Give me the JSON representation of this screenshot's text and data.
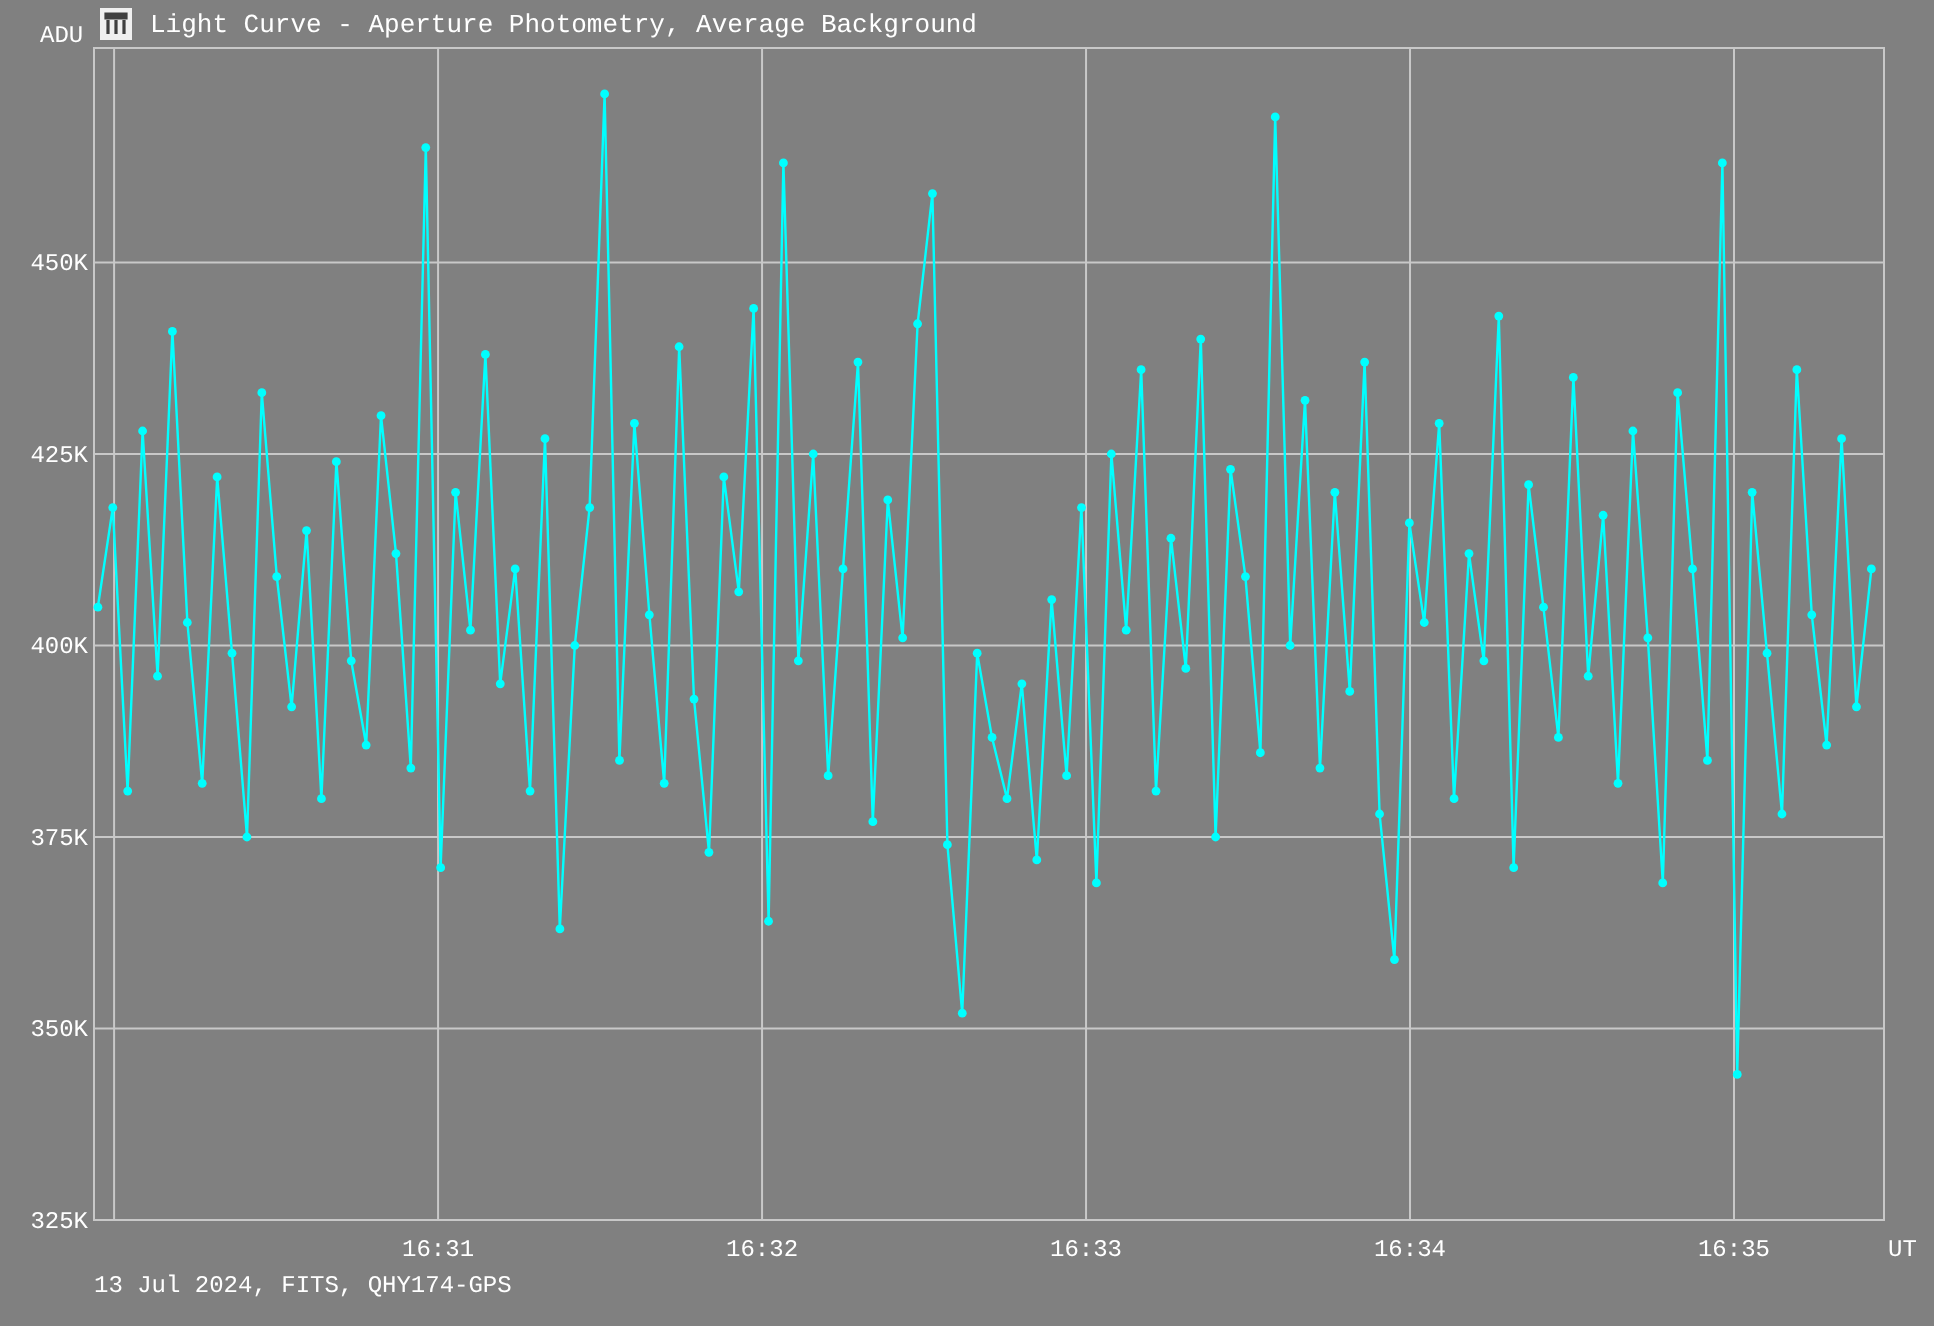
{
  "window": {
    "title": "Light Curve - Aperture Photometry, Average Background"
  },
  "chart": {
    "chart_data": {
      "type": "line",
      "grid": true,
      "ylabel": "ADU",
      "xlabel": "UT",
      "xlim": [
        989.938,
        995.463
      ],
      "ylim": [
        325000,
        478000
      ],
      "xticks": [
        {
          "value": 991,
          "label": "16:31"
        },
        {
          "value": 992,
          "label": "16:32"
        },
        {
          "value": 993,
          "label": "16:33"
        },
        {
          "value": 994,
          "label": "16:34"
        },
        {
          "value": 995,
          "label": "16:35"
        }
      ],
      "yticks": [
        {
          "value": 325000,
          "label": "325K"
        },
        {
          "value": 350000,
          "label": "350K"
        },
        {
          "value": 375000,
          "label": "375K"
        },
        {
          "value": 400000,
          "label": "400K"
        },
        {
          "value": 425000,
          "label": "425K"
        },
        {
          "value": 450000,
          "label": "450K"
        }
      ],
      "x": [
        989.95,
        989.996,
        990.042,
        990.088,
        990.134,
        990.18,
        990.226,
        990.272,
        990.318,
        990.364,
        990.41,
        990.456,
        990.502,
        990.548,
        990.594,
        990.64,
        990.686,
        990.732,
        990.778,
        990.824,
        990.87,
        990.916,
        990.962,
        991.008,
        991.054,
        991.1,
        991.146,
        991.192,
        991.238,
        991.284,
        991.33,
        991.376,
        991.422,
        991.468,
        991.514,
        991.56,
        991.606,
        991.652,
        991.698,
        991.744,
        991.79,
        991.836,
        991.882,
        991.928,
        991.974,
        992.02,
        992.066,
        992.112,
        992.158,
        992.204,
        992.25,
        992.296,
        992.342,
        992.388,
        992.434,
        992.48,
        992.526,
        992.572,
        992.618,
        992.664,
        992.71,
        992.756,
        992.802,
        992.848,
        992.894,
        992.94,
        992.986,
        993.032,
        993.078,
        993.124,
        993.17,
        993.216,
        993.262,
        993.308,
        993.354,
        993.4,
        993.446,
        993.492,
        993.538,
        993.584,
        993.63,
        993.676,
        993.722,
        993.768,
        993.814,
        993.86,
        993.906,
        993.952,
        993.998,
        994.044,
        994.09,
        994.136,
        994.182,
        994.228,
        994.274,
        994.32,
        994.366,
        994.412,
        994.458,
        994.504,
        994.55,
        994.596,
        994.642,
        994.688,
        994.734,
        994.78,
        994.826,
        994.872,
        994.918,
        994.964,
        995.01,
        995.056,
        995.102,
        995.148,
        995.194,
        995.24,
        995.286,
        995.332,
        995.378,
        995.424
      ],
      "series": [
        {
          "color": "#00ffff",
          "marker": "circle",
          "values": [
            405000,
            418000,
            381000,
            428000,
            396000,
            441000,
            403000,
            382000,
            422000,
            399000,
            375000,
            433000,
            409000,
            392000,
            415000,
            380000,
            424000,
            398000,
            387000,
            430000,
            412000,
            384000,
            465000,
            371000,
            420000,
            402000,
            438000,
            395000,
            410000,
            381000,
            427000,
            363000,
            400000,
            418000,
            472000,
            385000,
            429000,
            404000,
            382000,
            439000,
            393000,
            373000,
            422000,
            407000,
            444000,
            364000,
            463000,
            398000,
            425000,
            383000,
            410000,
            437000,
            377000,
            419000,
            401000,
            442000,
            459000,
            374000,
            352000,
            399000,
            388000,
            380000,
            395000,
            372000,
            406000,
            383000,
            418000,
            369000,
            425000,
            402000,
            436000,
            381000,
            414000,
            397000,
            440000,
            375000,
            423000,
            409000,
            386000,
            469000,
            400000,
            432000,
            384000,
            420000,
            394000,
            437000,
            378000,
            359000,
            416000,
            403000,
            429000,
            380000,
            412000,
            398000,
            443000,
            371000,
            421000,
            405000,
            388000,
            435000,
            396000,
            417000,
            382000,
            428000,
            401000,
            369000,
            433000,
            410000,
            385000,
            463000,
            344000,
            420000,
            399000,
            378000,
            436000,
            404000,
            387000,
            427000,
            392000,
            410000
          ]
        }
      ]
    }
  },
  "footer": "13 Jul 2024, FITS, QHY174-GPS"
}
